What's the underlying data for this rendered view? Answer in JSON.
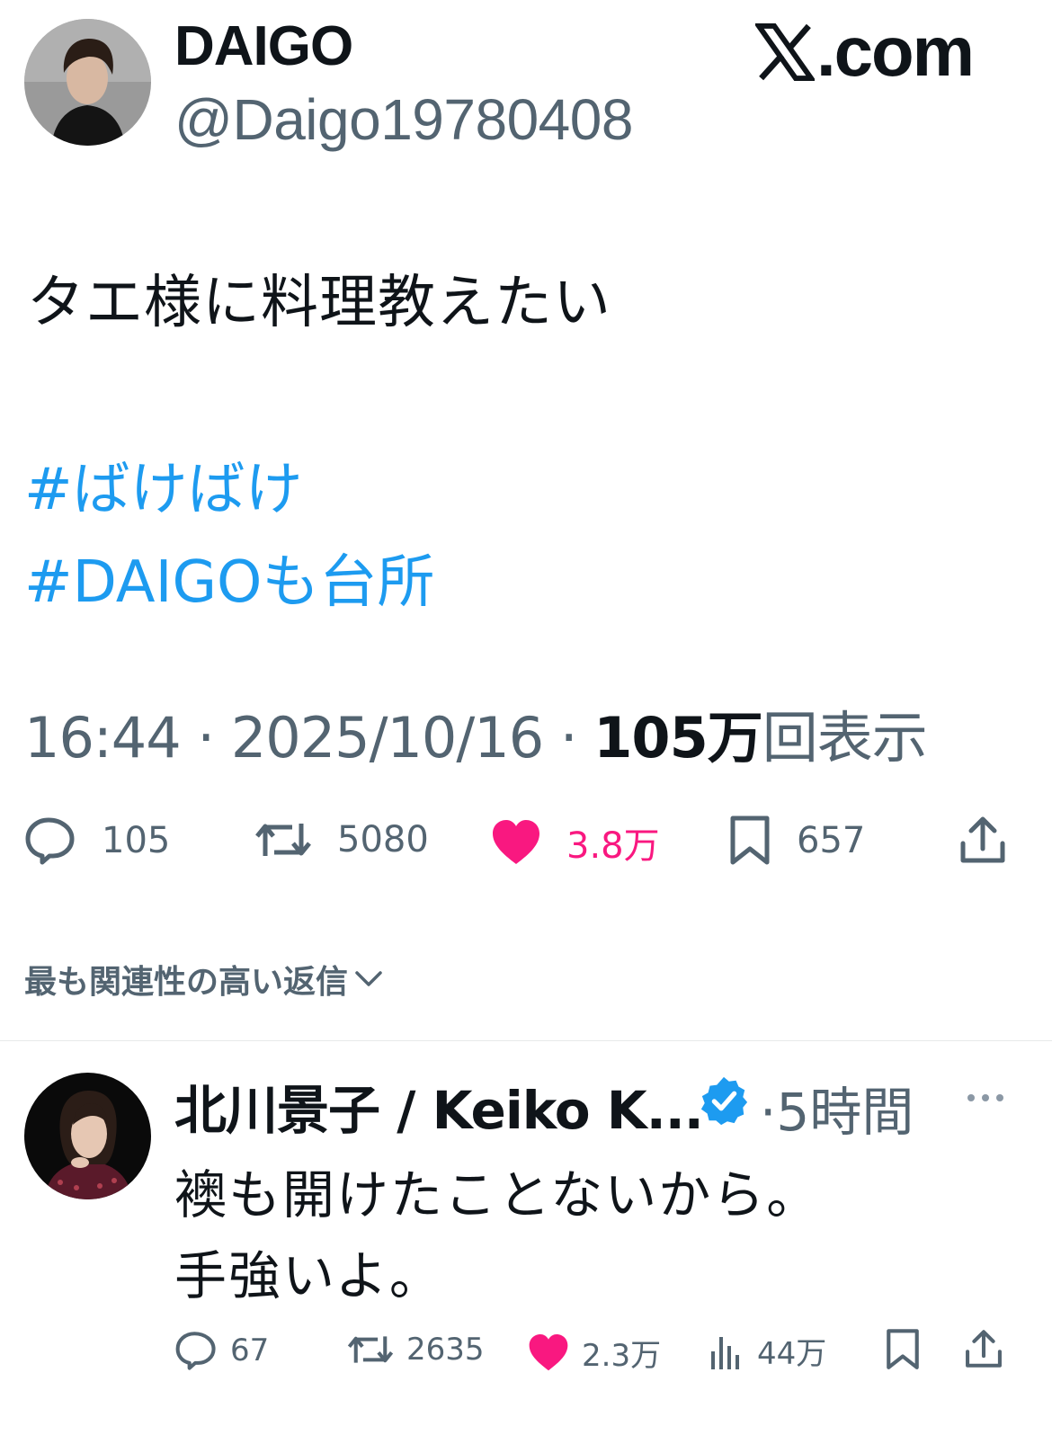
{
  "brand": {
    "label": ".com"
  },
  "author": {
    "name": "DAIGO",
    "handle": "@Daigo19780408"
  },
  "tweet": {
    "text": "タエ様に料理教えたい",
    "hashtags": [
      "#ばけばけ",
      "#DAIGOも台所"
    ],
    "time": "16:44",
    "date": "2025/10/16",
    "views_count": "105万",
    "views_label": "回表示",
    "separator": " · "
  },
  "actions": {
    "replies": "105",
    "reposts": "5080",
    "likes": "3.8万",
    "bookmarks": "657"
  },
  "replies_sort": {
    "label": "最も関連性の高い返信"
  },
  "reply": {
    "name": "北川景子 / Keiko K...",
    "time": "·5時間",
    "text_lines": [
      "襖も開けたことないから。",
      "手強いよ。"
    ],
    "actions": {
      "replies": "67",
      "reposts": "2635",
      "likes": "2.3万",
      "views": "44万"
    }
  },
  "colors": {
    "text_primary": "#0f1419",
    "text_secondary": "#536471",
    "link": "#1d9bf0",
    "like": "#f91880",
    "divider": "#e7e9ea"
  },
  "icons": [
    "x-logo-icon",
    "reply-icon",
    "repost-icon",
    "heart-filled-icon",
    "bookmark-icon",
    "share-icon",
    "chevron-down-icon",
    "verified-badge-icon",
    "more-icon",
    "views-icon"
  ]
}
